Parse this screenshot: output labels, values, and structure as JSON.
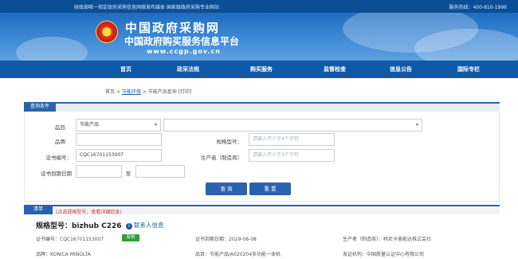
{
  "topbar": {
    "notice": "财政部唯一指定政府采购信息网络发布媒体 国家级政府采购专业网站",
    "hotline": "服务热线：400-810-1996"
  },
  "header": {
    "emblem_glyph": "★",
    "title": "中国政府采购网",
    "subtitle": "中国政府购买服务信息平台",
    "url": "www.ccgp.gov.cn"
  },
  "nav": {
    "items": [
      "首页",
      "政采法规",
      "购买服务",
      "监督检查",
      "信息公告",
      "国际专栏"
    ]
  },
  "breadcrumb": {
    "home": "首页",
    "sep1": ">",
    "section": "节能环保",
    "sep2": ">",
    "page": "节能产品查询",
    "print": "[打印]"
  },
  "query": {
    "tab": "查询条件",
    "category_label": "品目:",
    "category_value": "节能产品",
    "subcategory_value": "",
    "brand_label": "品牌:",
    "brand_value": "",
    "model_label": "规格型号：",
    "model_placeholder": "请输入不少于4个字符",
    "cert_label": "证书编号：",
    "cert_value": "CQC16701153007",
    "maker_label": "生产者（制造商）",
    "maker_placeholder": "请输入不少于3个字符",
    "expiry_label": "证书到期日期",
    "to_label": "至",
    "search_button": "查 询",
    "reset_button": "重 置"
  },
  "list": {
    "tab": "清单",
    "hint": "(点击规格型号，查看详细信息)",
    "item": {
      "title": "规格型号：bizhub C226",
      "contact": "联系人信息",
      "cert": "证书编号：CQC16701153007",
      "status": "有效",
      "expiry": "证书到期日期：2029-08-08",
      "maker": "生产者（制造商）：柯尼卡美能达株式会社",
      "brand": "品牌：KONICA MINOLTA",
      "product": "品目：节能产品/A020204多功能一体机",
      "issuer": "发证机构：中国质量认证中心有限公司"
    }
  },
  "colors": {
    "brand_blue": "#0f5aa8",
    "accent_blue": "#2a63ad",
    "valid_green": "#2aa33a",
    "hint_red": "#d0312d"
  }
}
